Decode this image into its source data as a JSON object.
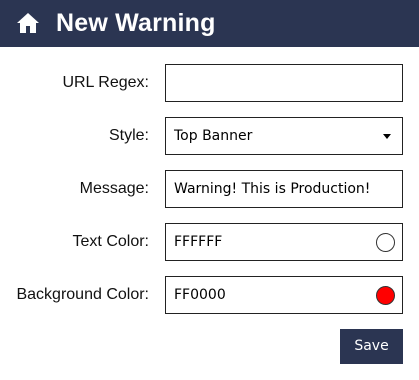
{
  "header": {
    "title": "New Warning",
    "icon": "home-icon",
    "background": "#2b3552"
  },
  "form": {
    "url_regex": {
      "label": "URL Regex:",
      "value": ""
    },
    "style": {
      "label": "Style:",
      "value": "Top Banner"
    },
    "message": {
      "label": "Message:",
      "value": "Warning! This is Production!"
    },
    "text_color": {
      "label": "Text Color:",
      "value": "FFFFFF",
      "swatch": "#FFFFFF"
    },
    "background_color": {
      "label": "Background Color:",
      "value": "FF0000",
      "swatch": "#FF0000"
    }
  },
  "actions": {
    "save_label": "Save"
  }
}
